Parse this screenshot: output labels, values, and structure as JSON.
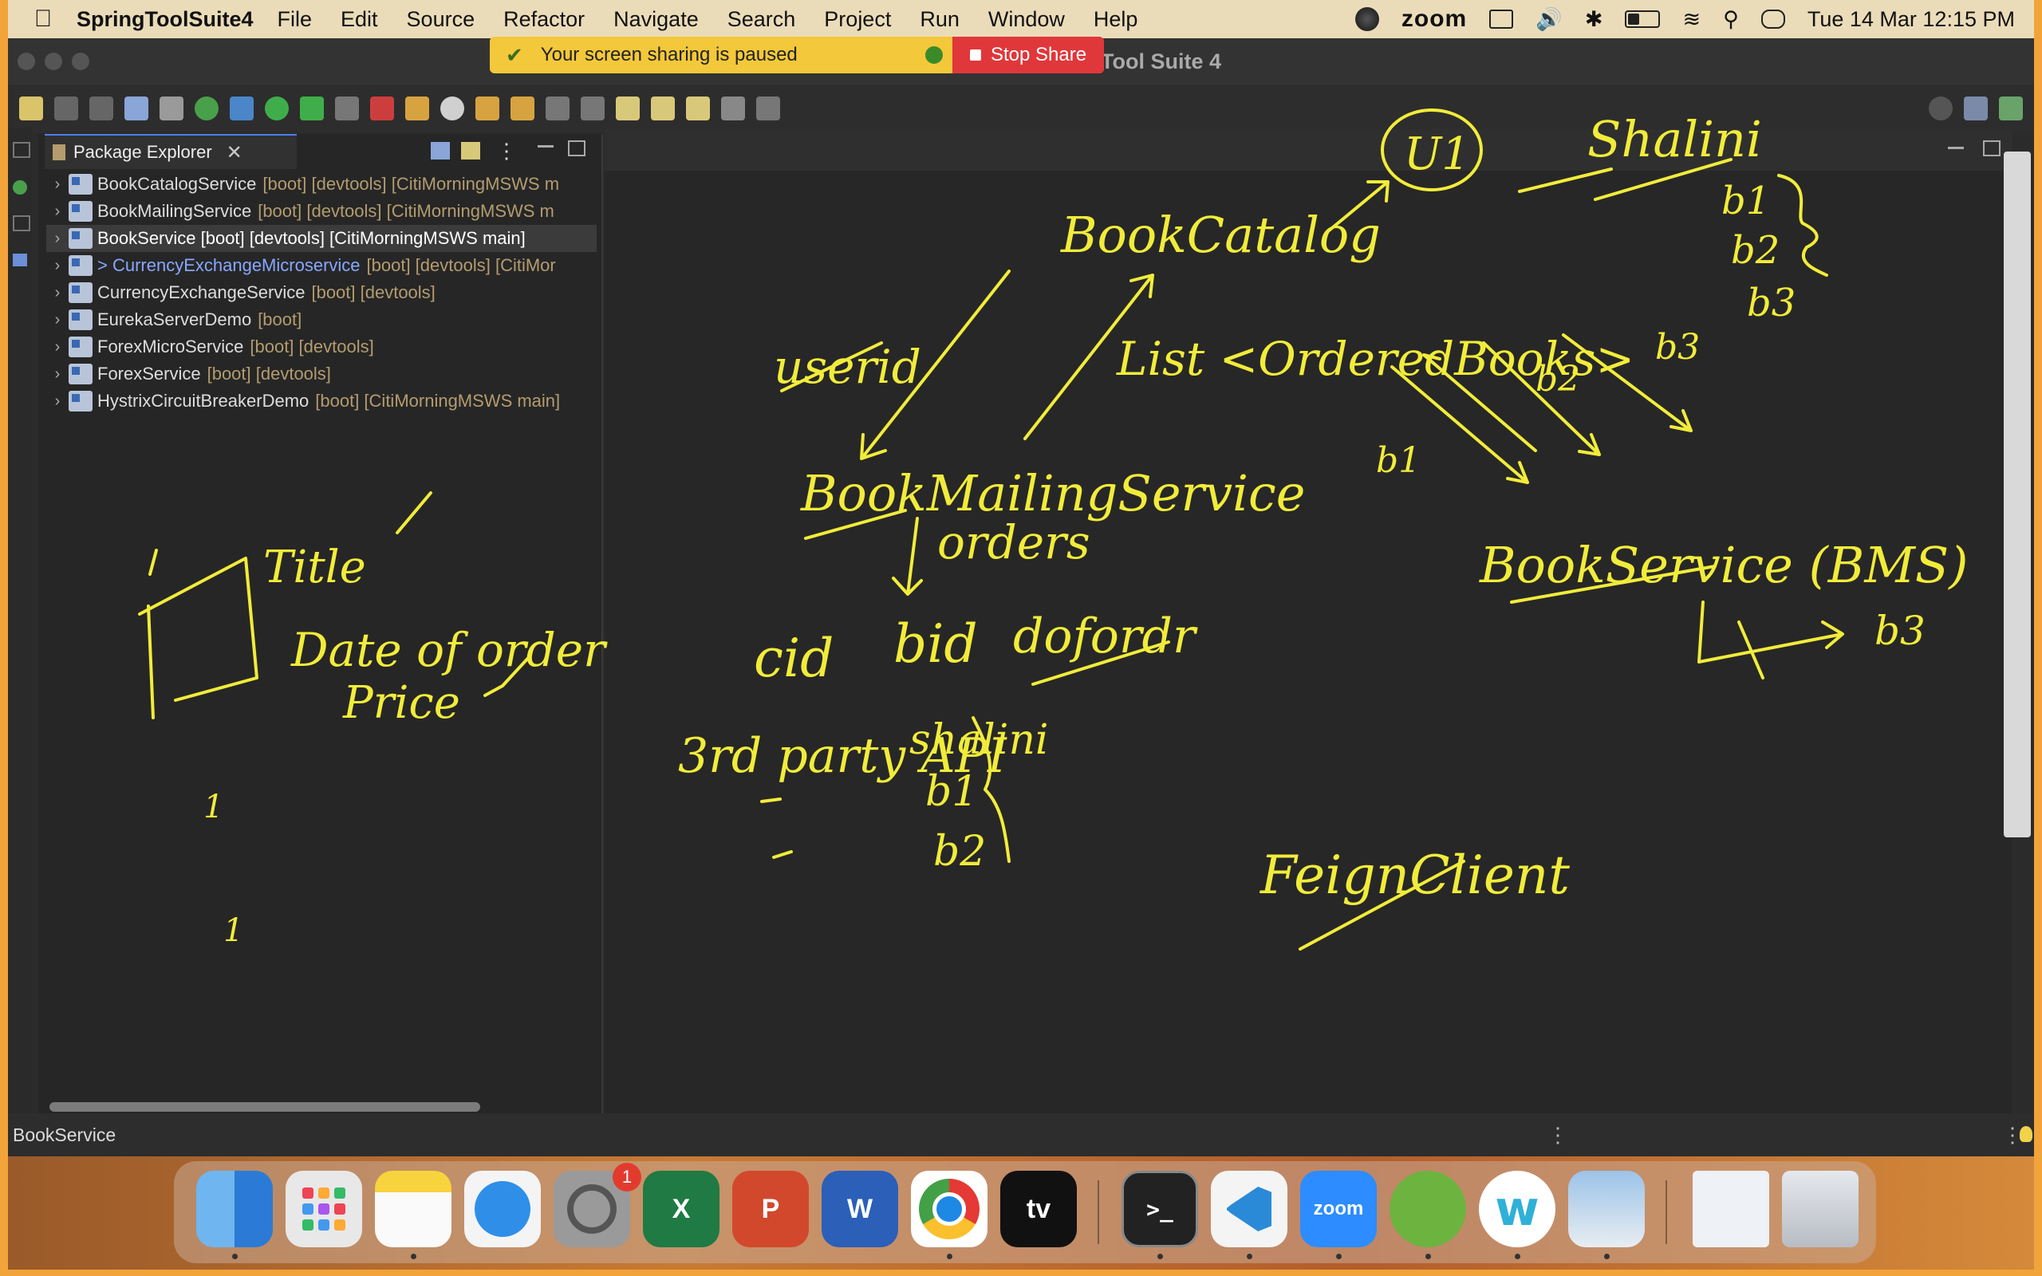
{
  "menubar": {
    "app_name": "SpringToolSuite4",
    "menus": [
      "File",
      "Edit",
      "Source",
      "Refactor",
      "Navigate",
      "Search",
      "Project",
      "Run",
      "Window",
      "Help"
    ],
    "zoom_label": "zoom",
    "clock": "Tue 14 Mar  12:15 PM"
  },
  "window": {
    "title": "Tool Suite 4"
  },
  "share_banner": {
    "message": "Your screen sharing is paused",
    "stop_label": "Stop Share"
  },
  "package_explorer": {
    "tab_label": "Package Explorer",
    "projects": [
      {
        "name": "BookCatalogService",
        "tags": "[boot] [devtools] [CitiMorningMSWS m"
      },
      {
        "name": "BookMailingService",
        "tags": "[boot] [devtools] [CitiMorningMSWS m"
      },
      {
        "name": "BookService [boot] [devtools] [CitiMorningMSWS main]",
        "tags": ""
      },
      {
        "name": "> CurrencyExchangeMicroservice",
        "tags": "[boot] [devtools] [CitiMor"
      },
      {
        "name": "CurrencyExchangeService",
        "tags": "[boot] [devtools]"
      },
      {
        "name": "EurekaServerDemo",
        "tags": "[boot]"
      },
      {
        "name": "ForexMicroService",
        "tags": "[boot] [devtools]"
      },
      {
        "name": "ForexService",
        "tags": "[boot] [devtools]"
      },
      {
        "name": "HystrixCircuitBreakerDemo",
        "tags": "[boot] [CitiMorningMSWS main]"
      }
    ]
  },
  "status_bar": {
    "text": "BookService"
  },
  "whiteboard": {
    "notes": [
      "U1",
      "Shalini",
      "BookCatalog",
      "b1",
      "b2",
      "b3",
      "userid",
      "List <OrderedBooks>",
      "b2",
      "b3",
      "b1",
      "BookMailingService",
      "orders",
      "BookService (BMS)",
      "cid",
      "bid",
      "dofordr",
      "3rd party API",
      "shalini",
      "b1",
      "b2",
      "b3",
      "FeignClient",
      "Title",
      "Date of order",
      "Price",
      "1",
      "1"
    ]
  },
  "dock": {
    "apps": [
      "finder",
      "launchpad",
      "notes",
      "safari",
      "system-settings",
      "excel",
      "powerpoint",
      "word",
      "chrome",
      "apple-tv",
      "terminal",
      "vscode",
      "zoom",
      "spring-tool-suite",
      "webex",
      "preview",
      "textedit",
      "trash"
    ],
    "settings_badge": "1",
    "zoom_icon_label": "zoom",
    "word_icon_label": "W",
    "excel_icon_label": "X",
    "ppt_icon_label": "P",
    "tv_icon_label": "tv"
  }
}
